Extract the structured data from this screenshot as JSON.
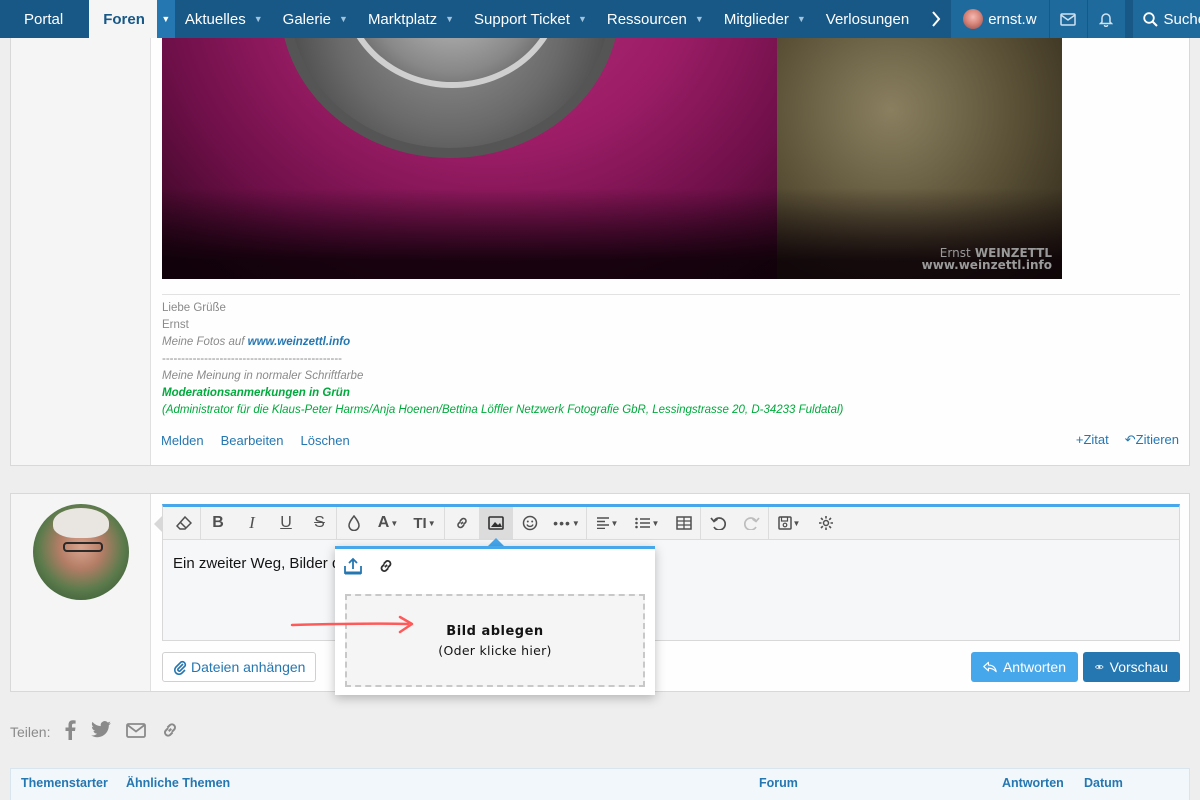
{
  "nav": {
    "tabs": [
      {
        "label": "Portal"
      },
      {
        "label": "Foren"
      },
      {
        "label": "Aktuelles"
      },
      {
        "label": "Galerie"
      },
      {
        "label": "Marktplatz"
      },
      {
        "label": "Support Ticket"
      },
      {
        "label": "Ressourcen"
      },
      {
        "label": "Mitglieder"
      },
      {
        "label": "Verlosungen"
      }
    ],
    "more_icon": "chevron-right-icon",
    "user_name": "ernst.w",
    "search_label": "Suche",
    "colors": {
      "bar": "#185886",
      "active_bg": "#f5f5f5",
      "active_text": "#185886"
    }
  },
  "post": {
    "image": {
      "watermark_line1": "Ernst",
      "watermark_line1_bold": "WEINZETTL",
      "watermark_line2": "www.weinzettl.info"
    },
    "signature": {
      "greeting": "Liebe Grüße",
      "name": "Ernst",
      "photos_prefix": "Meine Fotos auf ",
      "photos_link": "www.weinzettl.info",
      "dashes": "-----------------------------------------------",
      "opinion": "Meine Meinung in normaler Schriftfarbe",
      "moderation": "Moderationsanmerkungen in Grün",
      "admin_note": "(Administrator für die Klaus-Peter Harms/Anja Hoenen/Bettina Löffler Netzwerk Fotografie GbR, Lessingstrasse 20, D-34233 Fuldatal)"
    },
    "actions": {
      "report": "Melden",
      "edit": "Bearbeiten",
      "delete": "Löschen",
      "quote_add": "Zitat",
      "quote": "Zitieren"
    }
  },
  "reply": {
    "editor_text": "Ein zweiter Weg, Bilder d",
    "attach_label": "Dateien anhängen",
    "reply_label": "Antworten",
    "preview_label": "Vorschau",
    "toolbar": {
      "clear_icon": "eraser-icon",
      "bold": "B",
      "italic": "I",
      "underline": "U",
      "strike": "S",
      "font_size": "TI"
    }
  },
  "image_popup": {
    "title": "Bild ablegen",
    "subtitle": "(Oder klicke hier)"
  },
  "share": {
    "label": "Teilen:"
  },
  "similar_threads": {
    "columns": [
      "Themenstarter",
      "Ähnliche Themen",
      "Forum",
      "Antworten",
      "Datum"
    ]
  }
}
